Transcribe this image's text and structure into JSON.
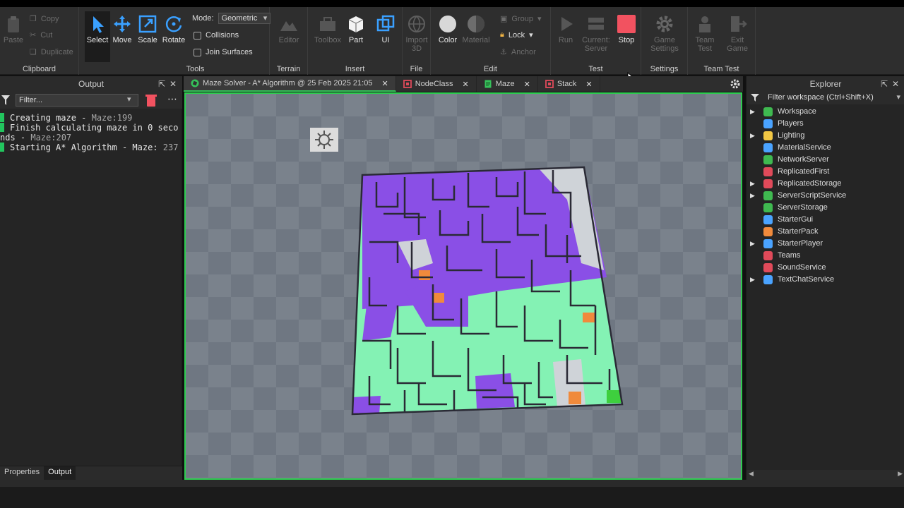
{
  "ribbon": {
    "clipboard": {
      "label": "Clipboard",
      "paste": "Paste",
      "copy": "Copy",
      "cut": "Cut",
      "duplicate": "Duplicate"
    },
    "tools": {
      "label": "Tools",
      "select": "Select",
      "move": "Move",
      "scale": "Scale",
      "rotate": "Rotate",
      "mode_label": "Mode:",
      "mode_value": "Geometric",
      "collisions": "Collisions",
      "join_surfaces": "Join Surfaces"
    },
    "terrain": {
      "label": "Terrain",
      "editor": "Editor"
    },
    "insert": {
      "label": "Insert",
      "toolbox": "Toolbox",
      "part": "Part",
      "ui": "UI"
    },
    "file": {
      "label": "File",
      "import": "Import 3D"
    },
    "edit": {
      "label": "Edit",
      "color": "Color",
      "material": "Material",
      "group": "Group",
      "lock": "Lock",
      "anchor": "Anchor"
    },
    "test": {
      "label": "Test",
      "run": "Run",
      "current": "Current: Server",
      "stop": "Stop"
    },
    "settings": {
      "label": "Settings",
      "game_settings": "Game Settings"
    },
    "team_test": {
      "label": "Team Test",
      "team_test": "Team Test",
      "exit_game": "Exit Game"
    }
  },
  "output": {
    "title": "Output",
    "filter_placeholder": "Filter...",
    "logs": [
      {
        "text": "Creating maze - ",
        "src": "Maze:199"
      },
      {
        "text": "Finish calculating maze in 0 seconds - ",
        "src": "Maze:207"
      },
      {
        "text": "Starting A* Algorithm - Maze: ",
        "src": "237"
      }
    ],
    "tabs": [
      "Properties",
      "Output"
    ]
  },
  "doc_tabs": [
    {
      "label": "Maze Solver - A* Algorithm @ 25 Feb 2025 21:05",
      "icon": "studio-icon",
      "color": "#36c25a"
    },
    {
      "label": "NodeClass",
      "icon": "module-script-icon",
      "color": "#e04a5a"
    },
    {
      "label": "Maze",
      "icon": "script-icon",
      "color": "#36c25a"
    },
    {
      "label": "Stack",
      "icon": "module-script-icon",
      "color": "#e04a5a"
    }
  ],
  "explorer": {
    "title": "Explorer",
    "filter": "Filter workspace (Ctrl+Shift+X)",
    "items": [
      {
        "label": "Workspace",
        "expandable": true,
        "color": "#3fb950"
      },
      {
        "label": "Players",
        "expandable": false,
        "color": "#4aa3ff"
      },
      {
        "label": "Lighting",
        "expandable": true,
        "color": "#f2c744"
      },
      {
        "label": "MaterialService",
        "expandable": false,
        "color": "#4aa3ff"
      },
      {
        "label": "NetworkServer",
        "expandable": false,
        "color": "#3fb950"
      },
      {
        "label": "ReplicatedFirst",
        "expandable": false,
        "color": "#e04a5a"
      },
      {
        "label": "ReplicatedStorage",
        "expandable": true,
        "color": "#e04a5a"
      },
      {
        "label": "ServerScriptService",
        "expandable": true,
        "color": "#3fb950"
      },
      {
        "label": "ServerStorage",
        "expandable": false,
        "color": "#3fb950"
      },
      {
        "label": "StarterGui",
        "expandable": false,
        "color": "#4aa3ff"
      },
      {
        "label": "StarterPack",
        "expandable": false,
        "color": "#f08a3c"
      },
      {
        "label": "StarterPlayer",
        "expandable": true,
        "color": "#4aa3ff"
      },
      {
        "label": "Teams",
        "expandable": false,
        "color": "#e04a5a"
      },
      {
        "label": "SoundService",
        "expandable": false,
        "color": "#e04a5a"
      },
      {
        "label": "TextChatService",
        "expandable": true,
        "color": "#4aa3ff"
      }
    ]
  }
}
